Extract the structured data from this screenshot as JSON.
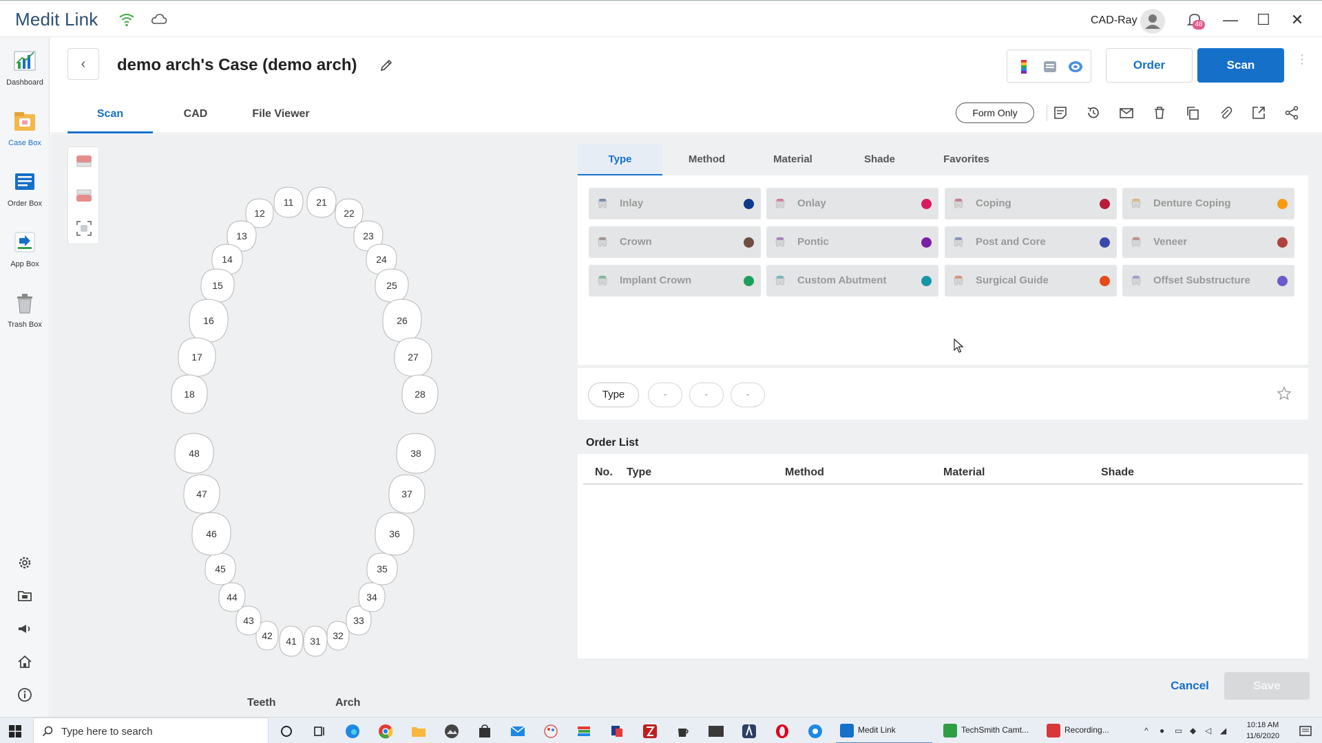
{
  "window": {
    "app_title": "Medit Link",
    "user_name": "CAD-Ray",
    "notification_count": "48",
    "minimize": "—",
    "maximize": "☐",
    "close": "✕"
  },
  "sidebar": {
    "items": [
      {
        "label": "Dashboard",
        "icon": "dashboard-icon"
      },
      {
        "label": "Case Box",
        "icon": "case-box-icon",
        "active": true
      },
      {
        "label": "Order Box",
        "icon": "order-box-icon"
      },
      {
        "label": "App Box",
        "icon": "app-box-icon"
      },
      {
        "label": "Trash Box",
        "icon": "trash-box-icon"
      }
    ],
    "bottom_icons": [
      "settings-icon",
      "folder-icon",
      "announcement-icon",
      "home-icon",
      "info-icon"
    ]
  },
  "case": {
    "back": "‹",
    "title": "demo arch's Case (demo arch)",
    "order_label": "Order",
    "scan_label": "Scan",
    "tabs": [
      {
        "label": "Scan",
        "active": true
      },
      {
        "label": "CAD"
      },
      {
        "label": "File Viewer"
      }
    ],
    "form_only_label": "Form Only",
    "action_icons": [
      "form-icon",
      "history-icon",
      "mail-icon",
      "delete-icon",
      "copy-icon",
      "attach-icon",
      "export-icon",
      "share-icon"
    ]
  },
  "tooth_chart": {
    "upper": [
      "11",
      "12",
      "13",
      "14",
      "15",
      "16",
      "17",
      "18",
      "21",
      "22",
      "23",
      "24",
      "25",
      "26",
      "27",
      "28"
    ],
    "lower": [
      "31",
      "32",
      "33",
      "34",
      "35",
      "36",
      "37",
      "38",
      "41",
      "42",
      "43",
      "44",
      "45",
      "46",
      "47",
      "48"
    ],
    "bottom_tabs": [
      "Teeth",
      "Arch"
    ]
  },
  "order_form": {
    "category_tabs": [
      {
        "label": "Type",
        "active": true
      },
      {
        "label": "Method"
      },
      {
        "label": "Material"
      },
      {
        "label": "Shade"
      },
      {
        "label": "Favorites"
      }
    ],
    "types": [
      {
        "label": "Inlay",
        "color": "#0d3b8c"
      },
      {
        "label": "Onlay",
        "color": "#d81b60"
      },
      {
        "label": "Coping",
        "color": "#b71c3c"
      },
      {
        "label": "Denture Coping",
        "color": "#f39c12"
      },
      {
        "label": "Crown",
        "color": "#6d4c41"
      },
      {
        "label": "Pontic",
        "color": "#7b1fa2"
      },
      {
        "label": "Post and Core",
        "color": "#3949ab"
      },
      {
        "label": "Veneer",
        "color": "#b0413e"
      },
      {
        "label": "Implant Crown",
        "color": "#1e9e5a"
      },
      {
        "label": "Custom Abutment",
        "color": "#1597a8"
      },
      {
        "label": "Surgical Guide",
        "color": "#e64a19"
      },
      {
        "label": "Offset Substructure",
        "color": "#6a5acd"
      }
    ],
    "selection": {
      "type_pill": "Type",
      "empty_pills": [
        "-",
        "-",
        "-"
      ]
    },
    "order_list": {
      "title": "Order List",
      "columns": [
        "No.",
        "Type",
        "Method",
        "Material",
        "Shade"
      ]
    },
    "cancel_label": "Cancel",
    "save_label": "Save"
  },
  "taskbar": {
    "search_placeholder": "Type here to search",
    "apps": [
      {
        "label": "Medit Link",
        "color": "#1570c9"
      },
      {
        "label": "TechSmith Camt...",
        "color": "#2f9e44"
      },
      {
        "label": "Recording...",
        "color": "#d9383a"
      }
    ],
    "time": "10:18 AM",
    "date": "11/6/2020"
  }
}
